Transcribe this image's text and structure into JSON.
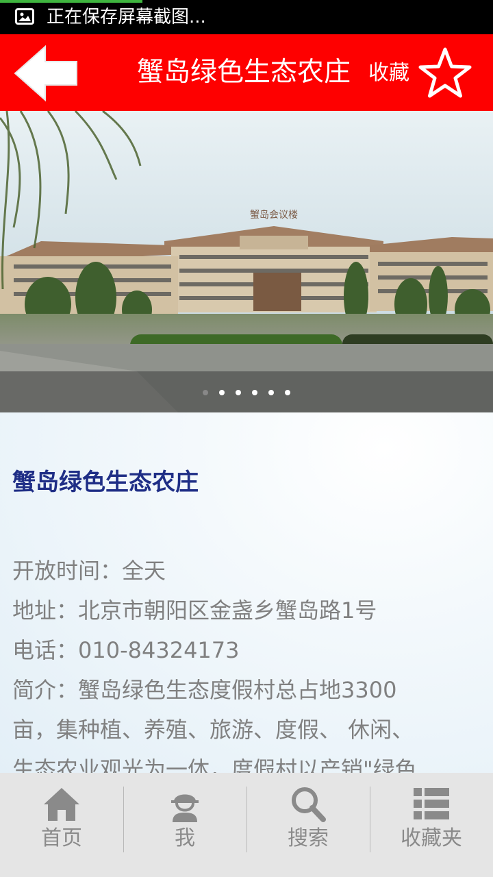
{
  "status_bar": {
    "notification_text": "正在保存屏幕截图...",
    "notification_icon": "image-icon"
  },
  "header": {
    "back_icon": "back-arrow-icon",
    "title": "蟹岛绿色生态农庄",
    "favorite_label": "收藏",
    "favorite_icon": "star-outline-icon",
    "background_color": "#fe0000"
  },
  "banner": {
    "image_description_icon": "resort-building-photo",
    "pager": {
      "total": 6,
      "active_index": 1
    },
    "sign_text": "蟹岛会议楼"
  },
  "detail": {
    "name": "蟹岛绿色生态农庄",
    "lines": [
      "开放时间：全天",
      "地址：北京市朝阳区金盏乡蟹岛路1号",
      "电话：010-84324173",
      "简介：蟹岛绿色生态度假村总占地3300",
      "亩，集种植、养殖、旅游、度假、 休闲、",
      "生态农业观光为一体，度假村以产销\"绿色"
    ]
  },
  "tabbar": {
    "tabs": [
      {
        "label": "首页",
        "icon": "home-icon"
      },
      {
        "label": "我",
        "icon": "user-icon"
      },
      {
        "label": "搜索",
        "icon": "search-icon"
      },
      {
        "label": "收藏夹",
        "icon": "list-icon"
      }
    ]
  }
}
